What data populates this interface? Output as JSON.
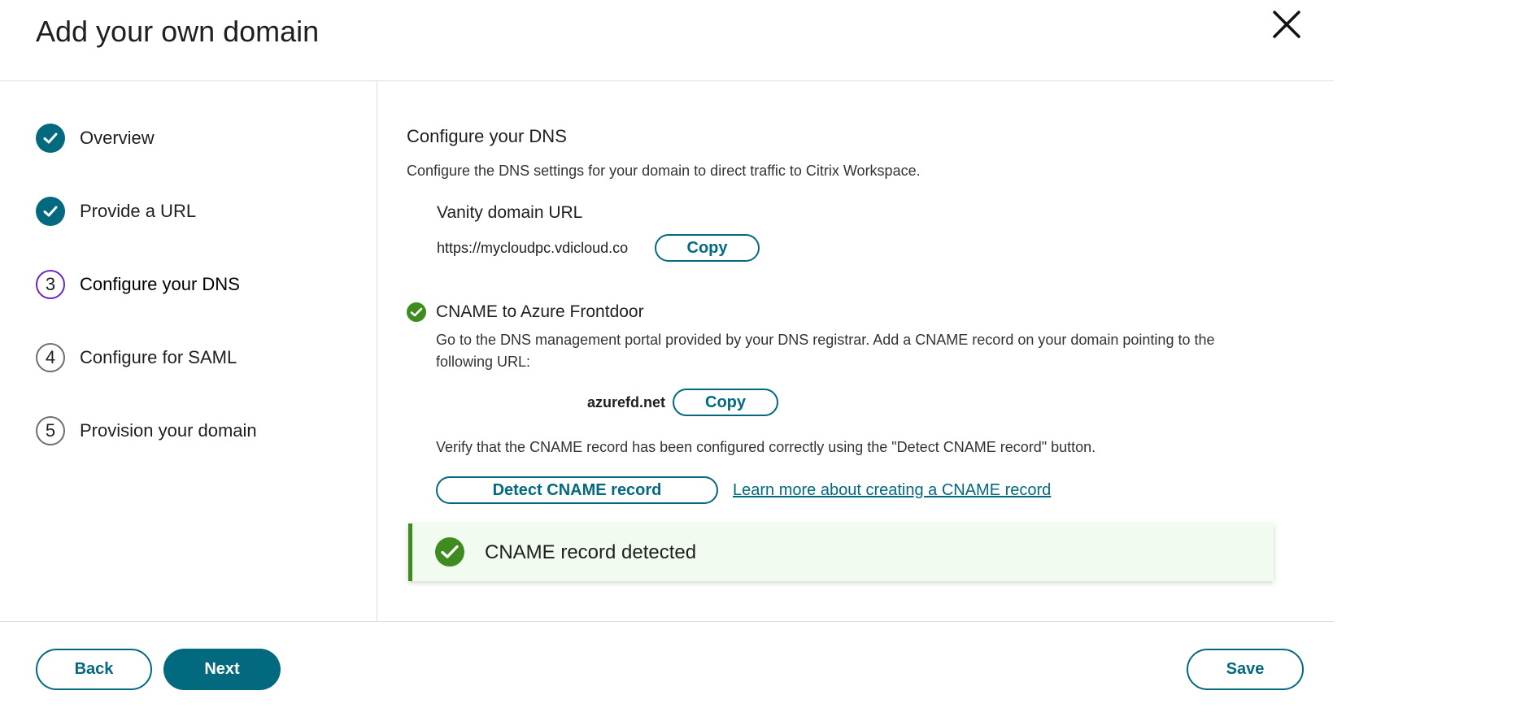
{
  "dialog": {
    "title": "Add your own domain",
    "close_icon": "close-icon"
  },
  "steps": [
    {
      "label": "Overview",
      "state": "done",
      "icon": "check-icon"
    },
    {
      "label": "Provide a URL",
      "state": "done",
      "icon": "check-icon"
    },
    {
      "label": "Configure your DNS",
      "state": "active",
      "number": "3"
    },
    {
      "label": "Configure for SAML",
      "state": "todo",
      "number": "4"
    },
    {
      "label": "Provision your domain",
      "state": "todo",
      "number": "5"
    }
  ],
  "main": {
    "heading": "Configure your DNS",
    "description": "Configure the DNS settings for your domain to direct traffic to Citrix Workspace.",
    "vanity": {
      "label": "Vanity domain URL",
      "url": "https://mycloudpc.vdicloud.co",
      "copy_label": "Copy"
    },
    "cname": {
      "title": "CNAME to Azure Frontdoor",
      "description": "Go to the DNS management portal provided by your DNS registrar. Add a CNAME record on your domain pointing to the following URL:",
      "target_url": "azurefd.net",
      "copy_label": "Copy",
      "verify_text": "Verify that the CNAME record has been configured correctly using the \"Detect CNAME record\" button.",
      "detect_label": "Detect CNAME record",
      "learn_more": "Learn more about creating a CNAME record"
    },
    "toast": {
      "message": "CNAME record detected"
    }
  },
  "footer": {
    "back_label": "Back",
    "next_label": "Next",
    "save_label": "Save"
  },
  "colors": {
    "accent": "#02697f",
    "active_step": "#6b23c8",
    "success": "#3e8b20",
    "toast_bg": "#f1fbef"
  }
}
